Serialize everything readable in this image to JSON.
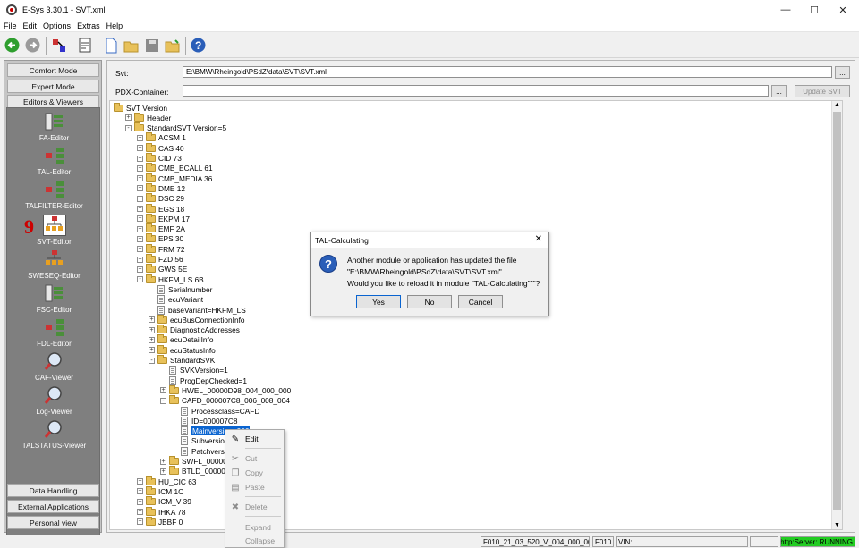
{
  "window": {
    "title": "E-Sys 3.30.1 - SVT.xml",
    "minimize": "—",
    "maximize": "☐",
    "close": "✕"
  },
  "menu": [
    "File",
    "Edit",
    "Options",
    "Extras",
    "Help"
  ],
  "left": {
    "top_buttons": [
      "Comfort Mode",
      "Expert Mode",
      "Editors & Viewers"
    ],
    "editors": [
      "FA-Editor",
      "TAL-Editor",
      "TALFILTER-Editor",
      "SVT-Editor",
      "SWESEQ-Editor",
      "FSC-Editor",
      "FDL-Editor",
      "CAF-Viewer",
      "Log-Viewer",
      "TALSTATUS-Viewer"
    ],
    "badge": "9",
    "bottom_buttons": [
      "Data Handling",
      "External Applications",
      "Personal view"
    ]
  },
  "svt": {
    "label": "Svt:",
    "value": "E:\\BMW\\Rheingold\\PSdZ\\data\\SVT\\SVT.xml",
    "browse": "..."
  },
  "pdx": {
    "label": "PDX-Container:",
    "value": "",
    "browse": "...",
    "update": "Update SVT"
  },
  "tree": [
    {
      "t": "SVT Version",
      "l": 0,
      "e": "",
      "i": "folder"
    },
    {
      "t": "Header",
      "l": 1,
      "e": "+",
      "i": "folder"
    },
    {
      "t": "StandardSVT Version=5",
      "l": 1,
      "e": "-",
      "i": "folder"
    },
    {
      "t": "ACSM 1",
      "l": 2,
      "e": "+",
      "i": "folder"
    },
    {
      "t": "CAS 40",
      "l": 2,
      "e": "+",
      "i": "folder"
    },
    {
      "t": "CID 73",
      "l": 2,
      "e": "+",
      "i": "folder"
    },
    {
      "t": "CMB_ECALL 61",
      "l": 2,
      "e": "+",
      "i": "folder"
    },
    {
      "t": "CMB_MEDIA 36",
      "l": 2,
      "e": "+",
      "i": "folder"
    },
    {
      "t": "DME 12",
      "l": 2,
      "e": "+",
      "i": "folder"
    },
    {
      "t": "DSC 29",
      "l": 2,
      "e": "+",
      "i": "folder"
    },
    {
      "t": "EGS 18",
      "l": 2,
      "e": "+",
      "i": "folder"
    },
    {
      "t": "EKPM 17",
      "l": 2,
      "e": "+",
      "i": "folder"
    },
    {
      "t": "EMF 2A",
      "l": 2,
      "e": "+",
      "i": "folder"
    },
    {
      "t": "EPS 30",
      "l": 2,
      "e": "+",
      "i": "folder"
    },
    {
      "t": "FRM 72",
      "l": 2,
      "e": "+",
      "i": "folder"
    },
    {
      "t": "FZD 56",
      "l": 2,
      "e": "+",
      "i": "folder"
    },
    {
      "t": "GWS 5E",
      "l": 2,
      "e": "+",
      "i": "folder"
    },
    {
      "t": "HKFM_LS 6B",
      "l": 2,
      "e": "-",
      "i": "folder"
    },
    {
      "t": "Serialnumber",
      "l": 3,
      "e": "",
      "i": "doc"
    },
    {
      "t": "ecuVariant",
      "l": 3,
      "e": "",
      "i": "doc"
    },
    {
      "t": "baseVariant=HKFM_LS",
      "l": 3,
      "e": "",
      "i": "doc"
    },
    {
      "t": "ecuBusConnectionInfo",
      "l": 3,
      "e": "+",
      "i": "folder"
    },
    {
      "t": "DiagnosticAddresses",
      "l": 3,
      "e": "+",
      "i": "folder"
    },
    {
      "t": "ecuDetailInfo",
      "l": 3,
      "e": "+",
      "i": "folder"
    },
    {
      "t": "ecuStatusInfo",
      "l": 3,
      "e": "+",
      "i": "folder"
    },
    {
      "t": "StandardSVK",
      "l": 3,
      "e": "-",
      "i": "folder"
    },
    {
      "t": "SVKVersion=1",
      "l": 4,
      "e": "",
      "i": "doc"
    },
    {
      "t": "ProgDepChecked=1",
      "l": 4,
      "e": "",
      "i": "doc"
    },
    {
      "t": "HWEL_00000D98_004_000_000",
      "l": 4,
      "e": "+",
      "i": "folder"
    },
    {
      "t": "CAFD_000007C8_006_008_004",
      "l": 4,
      "e": "-",
      "i": "folder"
    },
    {
      "t": "Processclass=CAFD",
      "l": 5,
      "e": "",
      "i": "doc"
    },
    {
      "t": "ID=000007C8",
      "l": 5,
      "e": "",
      "i": "doc"
    },
    {
      "t": "Mainversion=006",
      "l": 5,
      "e": "",
      "i": "doc",
      "sel": true
    },
    {
      "t": "Subversion=0",
      "l": 5,
      "e": "",
      "i": "doc"
    },
    {
      "t": "Patchversion=",
      "l": 5,
      "e": "",
      "i": "doc"
    },
    {
      "t": "SWFL_00000D9A",
      "l": 4,
      "e": "+",
      "i": "folder"
    },
    {
      "t": "BTLD_00000D99_",
      "l": 4,
      "e": "+",
      "i": "folder"
    },
    {
      "t": "HU_CIC 63",
      "l": 2,
      "e": "+",
      "i": "folder"
    },
    {
      "t": "ICM 1C",
      "l": 2,
      "e": "+",
      "i": "folder"
    },
    {
      "t": "ICM_V 39",
      "l": 2,
      "e": "+",
      "i": "folder"
    },
    {
      "t": "IHKA 78",
      "l": 2,
      "e": "+",
      "i": "folder"
    },
    {
      "t": "JBBF 0",
      "l": 2,
      "e": "+",
      "i": "folder"
    }
  ],
  "dialog": {
    "title": "TAL-Calculating",
    "line1": "Another module or application has updated the file",
    "line2": "\"E:\\BMW\\Rheingold\\PSdZ\\data\\SVT\\SVT.xml\".",
    "line3": "Would you like to reload it in module \"TAL-Calculating\"\"\"?",
    "yes": "Yes",
    "no": "No",
    "cancel": "Cancel"
  },
  "context_menu": [
    {
      "label": "Edit",
      "enabled": true
    },
    {
      "label": "Cut",
      "enabled": false
    },
    {
      "label": "Copy",
      "enabled": false
    },
    {
      "label": "Paste",
      "enabled": false
    },
    {
      "label": "Delete",
      "enabled": false
    },
    {
      "label": "Expand",
      "enabled": false
    },
    {
      "label": "Collapse",
      "enabled": false
    }
  ],
  "status": {
    "file": "F010_21_03_520_V_004_000_001",
    "series": "F010",
    "vin": "VIN:",
    "server": "http:Server: RUNNING"
  },
  "colors": {
    "server_bg": "#22cc22",
    "selection": "#0a64d0"
  }
}
